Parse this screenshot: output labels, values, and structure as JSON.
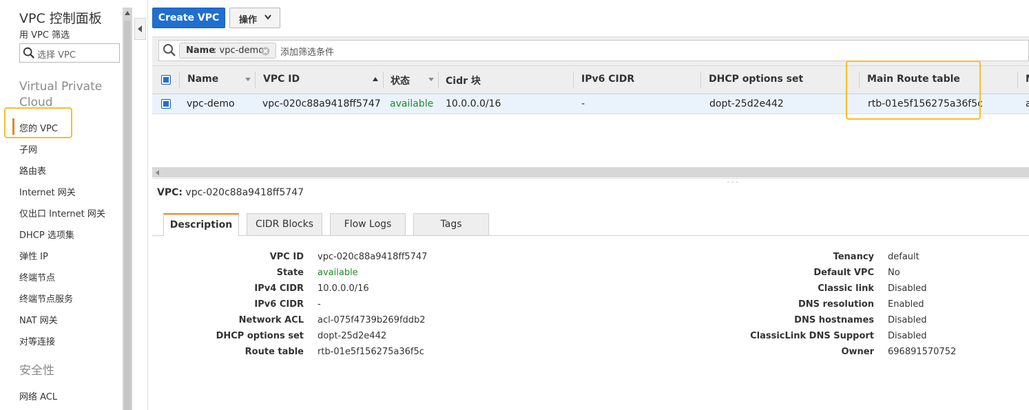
{
  "sidebar": {
    "title": "VPC 控制面板",
    "filter_label": "用 VPC 筛选",
    "search_placeholder": "选择 VPC",
    "section_vpc": "Virtual Private Cloud",
    "items": [
      "您的 VPC",
      "子网",
      "路由表",
      "Internet 网关",
      "仅出口 Internet 网关",
      "DHCP 选项集",
      "弹性 IP",
      "终端节点",
      "终端节点服务",
      "NAT 网关",
      "对等连接"
    ],
    "section_security": "安全性",
    "security_items": [
      "网络 ACL"
    ]
  },
  "toolbar": {
    "create_label": "Create VPC",
    "actions_label": "操作"
  },
  "filter": {
    "token_key": "Name",
    "token_value": ": vpc-demo",
    "placeholder": "添加筛选条件"
  },
  "table": {
    "columns": [
      "Name",
      "VPC ID",
      "状态",
      "Cidr 块",
      "IPv6 CIDR",
      "DHCP options set",
      "Main Route table",
      "M"
    ],
    "row": {
      "name": "vpc-demo",
      "vpc_id": "vpc-020c88a9418ff5747",
      "state": "available",
      "cidr": "10.0.0.0/16",
      "ipv6": "-",
      "dhcp": "dopt-25d2e442",
      "route_table": "rtb-01e5f156275a36f5c",
      "more": "a"
    }
  },
  "detail": {
    "vpc_prefix": "VPC:",
    "vpc_id": "vpc-020c88a9418ff5747",
    "tabs": [
      "Description",
      "CIDR Blocks",
      "Flow Logs",
      "Tags"
    ],
    "left": [
      {
        "label": "VPC ID",
        "value": "vpc-020c88a9418ff5747"
      },
      {
        "label": "State",
        "value": "available"
      },
      {
        "label": "IPv4 CIDR",
        "value": "10.0.0.0/16"
      },
      {
        "label": "IPv6 CIDR",
        "value": "-"
      },
      {
        "label": "Network ACL",
        "value": "acl-075f4739b269fddb2"
      },
      {
        "label": "DHCP options set",
        "value": "dopt-25d2e442"
      },
      {
        "label": "Route table",
        "value": "rtb-01e5f156275a36f5c"
      }
    ],
    "right": [
      {
        "label": "Tenancy",
        "value": "default"
      },
      {
        "label": "Default VPC",
        "value": "No"
      },
      {
        "label": "Classic link",
        "value": "Disabled"
      },
      {
        "label": "DNS resolution",
        "value": "Enabled"
      },
      {
        "label": "DNS hostnames",
        "value": "Disabled"
      },
      {
        "label": "ClassicLink DNS Support",
        "value": "Disabled"
      },
      {
        "label": "Owner",
        "value": "696891570752"
      }
    ]
  },
  "colors": {
    "primary": "#1f6fd1",
    "accent_orange": "#e7851c",
    "highlight_yellow": "#f6be2c",
    "status_green": "#208a2a",
    "link_blue": "#1a5fb4"
  }
}
